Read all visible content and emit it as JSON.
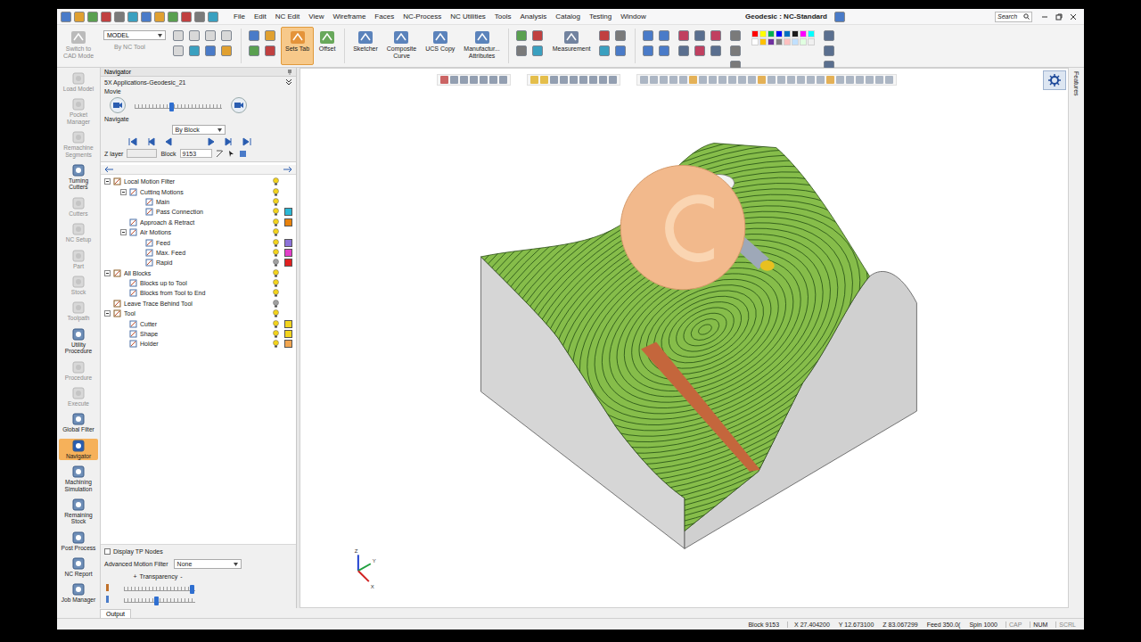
{
  "window": {
    "title": "Geodesic : NC-Standard",
    "search_placeholder": "Search",
    "menu": [
      "File",
      "Edit",
      "NC Edit",
      "View",
      "Wireframe",
      "Faces",
      "NC-Process",
      "NC Utilities",
      "Tools",
      "Analysis",
      "Catalog",
      "Testing",
      "Window"
    ]
  },
  "ribbon": {
    "mode_button": [
      "Switch to",
      "CAD Mode"
    ],
    "model_select": "MODEL",
    "by_nc_tool": "By NC Tool",
    "tools": [
      {
        "lines": [
          "Sets Tab"
        ],
        "selected": true
      },
      {
        "lines": [
          "Offset"
        ],
        "selected": false
      },
      {
        "lines": [
          "Sketcher"
        ],
        "selected": false
      },
      {
        "lines": [
          "Composite",
          "Curve"
        ],
        "selected": false
      },
      {
        "lines": [
          "UCS Copy"
        ],
        "selected": false
      },
      {
        "lines": [
          "Manufactur...",
          "Attributes"
        ],
        "selected": false
      },
      {
        "lines": [
          "Measurement"
        ],
        "selected": false
      }
    ],
    "palette": [
      "#ff0000",
      "#ffff00",
      "#00b050",
      "#0000ff",
      "#0070c0",
      "#1a1a1a",
      "#ff00ff",
      "#00ffff",
      "#ffffff",
      "#ffc000",
      "#7030a0",
      "#808080",
      "#ffc0c0",
      "#c0e0ff",
      "#e0ffe0",
      "#f0f0f0"
    ]
  },
  "sidebar": {
    "items": [
      {
        "label": "Load Model",
        "disabled": true,
        "selected": false
      },
      {
        "label": "Pocket Manager",
        "disabled": true,
        "selected": false
      },
      {
        "label": "Remachine Segments",
        "disabled": true,
        "selected": false
      },
      {
        "label": "Turning Cutters",
        "disabled": false,
        "selected": false
      },
      {
        "label": "Cutters",
        "disabled": true,
        "selected": false
      },
      {
        "label": "NC Setup",
        "disabled": true,
        "selected": false
      },
      {
        "label": "Part",
        "disabled": true,
        "selected": false
      },
      {
        "label": "Stock",
        "disabled": true,
        "selected": false
      },
      {
        "label": "Toolpath",
        "disabled": true,
        "selected": false
      },
      {
        "label": "Utility Procedure",
        "disabled": false,
        "selected": false
      },
      {
        "label": "Procedure",
        "disabled": true,
        "selected": false
      },
      {
        "label": "Execute",
        "disabled": true,
        "selected": false
      },
      {
        "label": "Global Filter",
        "disabled": false,
        "selected": false
      },
      {
        "label": "Navigator",
        "disabled": false,
        "selected": true
      },
      {
        "label": "Machining Simulation",
        "disabled": false,
        "selected": false
      },
      {
        "label": "Remaining Stock",
        "disabled": false,
        "selected": false
      },
      {
        "label": "Post Process",
        "disabled": false,
        "selected": false
      },
      {
        "label": "NC Report",
        "disabled": false,
        "selected": false
      },
      {
        "label": "Job Manager",
        "disabled": false,
        "selected": false
      }
    ]
  },
  "navigator": {
    "title": "Navigator",
    "file": "5X Applications-Geodesic_21",
    "movie_label": "Movie",
    "movie_level": 0.42,
    "navigate_label": "Navigate",
    "navigate_select": "By Block",
    "z_layer_label": "Z layer",
    "z_layer_value": "",
    "block_label": "Block",
    "block_value": "9153",
    "tree": [
      {
        "label": "Local Motion Filter",
        "level": 0,
        "kind": "group",
        "expanded": true,
        "on": true,
        "color": ""
      },
      {
        "label": "Cutting Motions",
        "level": 1,
        "kind": "group",
        "expanded": true,
        "on": true,
        "color": ""
      },
      {
        "label": "Main",
        "level": 2,
        "kind": "item",
        "on": true,
        "color": ""
      },
      {
        "label": "Pass Connection",
        "level": 2,
        "kind": "item",
        "on": true,
        "color": "#2bb8d6"
      },
      {
        "label": "Approach & Retract",
        "level": 1,
        "kind": "item",
        "on": true,
        "color": "#e8820c"
      },
      {
        "label": "Air Motions",
        "level": 1,
        "kind": "group",
        "expanded": true,
        "on": true,
        "color": ""
      },
      {
        "label": "Feed",
        "level": 2,
        "kind": "item",
        "on": true,
        "color": "#8c72d9"
      },
      {
        "label": "Max. Feed",
        "level": 2,
        "kind": "item",
        "on": true,
        "color": "#e23fc9"
      },
      {
        "label": "Rapid",
        "level": 2,
        "kind": "item",
        "on": false,
        "color": "#e02020"
      },
      {
        "label": "All Blocks",
        "level": 0,
        "kind": "group",
        "expanded": true,
        "on": true,
        "color": ""
      },
      {
        "label": "Blocks up to Tool",
        "level": 1,
        "kind": "item",
        "on": true,
        "color": ""
      },
      {
        "label": "Blocks from Tool to End",
        "level": 1,
        "kind": "item",
        "on": true,
        "color": ""
      },
      {
        "label": "Leave Trace Behind Tool",
        "level": 0,
        "kind": "item",
        "on": false,
        "color": ""
      },
      {
        "label": "Tool",
        "level": 0,
        "kind": "group",
        "expanded": true,
        "on": true,
        "color": ""
      },
      {
        "label": "Cutter",
        "level": 1,
        "kind": "item",
        "on": true,
        "color": "#f2d41e"
      },
      {
        "label": "Shape",
        "level": 1,
        "kind": "item",
        "on": true,
        "color": "#f2d41e"
      },
      {
        "label": "Holder",
        "level": 1,
        "kind": "item",
        "on": true,
        "color": "#f2a650"
      }
    ],
    "display_tp_nodes": {
      "label": "Display TP Nodes",
      "checked": false
    },
    "advanced_motion_filter": {
      "label": "Advanced Motion Filter",
      "value": "None"
    },
    "transparency": {
      "plus": "+",
      "label": "Transparency",
      "minus": "-",
      "sliders": [
        {
          "level": 0.95
        },
        {
          "level": 0.45
        }
      ]
    }
  },
  "viewport": {
    "side_tab": "Features",
    "axis_labels": [
      "Z",
      "Y",
      "X"
    ]
  },
  "output_tab": {
    "label": "Output",
    "selected": true
  },
  "status_bar": {
    "block": "Block 9153",
    "coords": [
      "X 27.404200",
      "Y 12.673100",
      "Z 83.067299",
      "Feed 350.0(",
      "Spin 1000"
    ],
    "flags": [
      "CAP",
      "NUM",
      "SCRL"
    ]
  }
}
